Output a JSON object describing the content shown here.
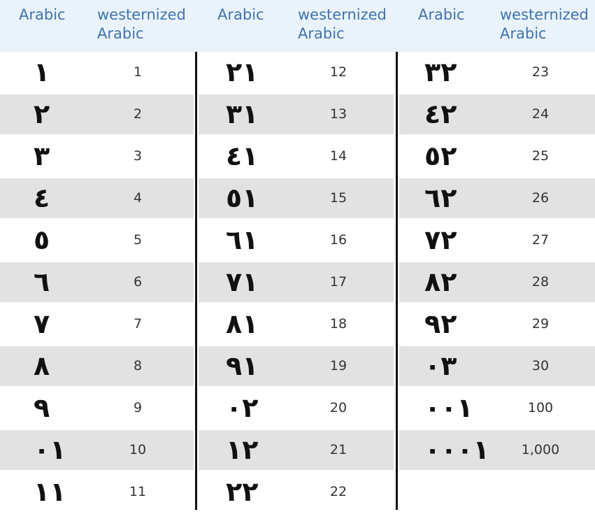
{
  "headers": [
    {
      "arabic": "Arabic",
      "western": "westernized Arabic",
      "western_line1": "westernized",
      "western_line2": "Arabic"
    },
    {
      "arabic": "Arabic",
      "western": "westernized Arabic",
      "western_line1": "westernized",
      "western_line2": "Arabic"
    },
    {
      "arabic": "Arabic",
      "western": "westernized Arabic",
      "western_line1": "westernized",
      "western_line2": "Arabic"
    }
  ],
  "columns": [
    [
      {
        "arabic": "١",
        "western": "1"
      },
      {
        "arabic": "٢",
        "western": "2"
      },
      {
        "arabic": "٣",
        "western": "3"
      },
      {
        "arabic": "٤",
        "western": "4"
      },
      {
        "arabic": "٥",
        "western": "5"
      },
      {
        "arabic": "٦",
        "western": "6"
      },
      {
        "arabic": "٧",
        "western": "7"
      },
      {
        "arabic": "٨",
        "western": "8"
      },
      {
        "arabic": "٩",
        "western": "9"
      },
      {
        "arabic": "١٠",
        "western": "10"
      },
      {
        "arabic": "١١",
        "western": "11"
      }
    ],
    [
      {
        "arabic": "١٢",
        "western": "12"
      },
      {
        "arabic": "١٣",
        "western": "13"
      },
      {
        "arabic": "١٤",
        "western": "14"
      },
      {
        "arabic": "١٥",
        "western": "15"
      },
      {
        "arabic": "١٦",
        "western": "16"
      },
      {
        "arabic": "١٧",
        "western": "17"
      },
      {
        "arabic": "١٨",
        "western": "18"
      },
      {
        "arabic": "١٩",
        "western": "19"
      },
      {
        "arabic": "٢٠",
        "western": "20"
      },
      {
        "arabic": "٢١",
        "western": "21"
      },
      {
        "arabic": "٢٢",
        "western": "22"
      }
    ],
    [
      {
        "arabic": "٢٣",
        "western": "23"
      },
      {
        "arabic": "٢٤",
        "western": "24"
      },
      {
        "arabic": "٢٥",
        "western": "25"
      },
      {
        "arabic": "٢٦",
        "western": "26"
      },
      {
        "arabic": "٢٧",
        "western": "27"
      },
      {
        "arabic": "٢٨",
        "western": "28"
      },
      {
        "arabic": "٢٩",
        "western": "29"
      },
      {
        "arabic": "٣٠",
        "western": "30"
      },
      {
        "arabic": "١٠٠",
        "western": "100"
      },
      {
        "arabic": "١٠٠٠",
        "western": "1,000"
      }
    ]
  ]
}
